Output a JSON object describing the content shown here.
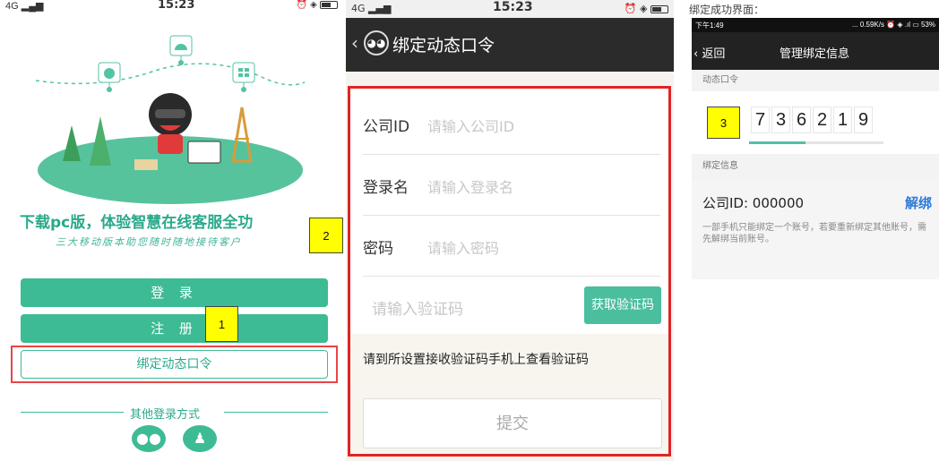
{
  "phone1": {
    "status": {
      "signal": "4G",
      "time": "15:23"
    },
    "headline": "下载pc版，体验智慧在线客服全功",
    "subline": "三大移动版本助您随时随地接待客户",
    "login_label": "登 录",
    "register_label": "注 册",
    "bind_label": "绑定动态口令",
    "other_login": "其他登录方式",
    "callouts": [
      "1",
      "2"
    ]
  },
  "phone2": {
    "status": {
      "signal": "4G",
      "time": "15:23"
    },
    "title": "绑定动态口令",
    "rows": [
      {
        "label": "公司ID",
        "placeholder": "请输入公司ID"
      },
      {
        "label": "登录名",
        "placeholder": "请输入登录名"
      },
      {
        "label": "密码",
        "placeholder": "请输入密码"
      }
    ],
    "code_placeholder": "请输入验证码",
    "get_code_label": "获取验证码",
    "hint": "请到所设置接收验证码手机上查看验证码",
    "submit_label": "提交"
  },
  "phone3": {
    "caption": "绑定成功界面：",
    "status": {
      "time": "下午1:49",
      "right": "... 0.59K/s ⏰ ◈ .ıl ▭ 53%"
    },
    "back_label": "返回",
    "title": "管理绑定信息",
    "token_section": "动态口令",
    "digits": [
      "7",
      "3",
      "6",
      "2",
      "1",
      "9"
    ],
    "token_progress": 0.42,
    "bind_section": "绑定信息",
    "company": "公司ID: 000000",
    "unbind_label": "解绑",
    "note": "一部手机只能绑定一个账号，若要重新绑定其他账号，需先解绑当前账号。",
    "callout": "3"
  }
}
